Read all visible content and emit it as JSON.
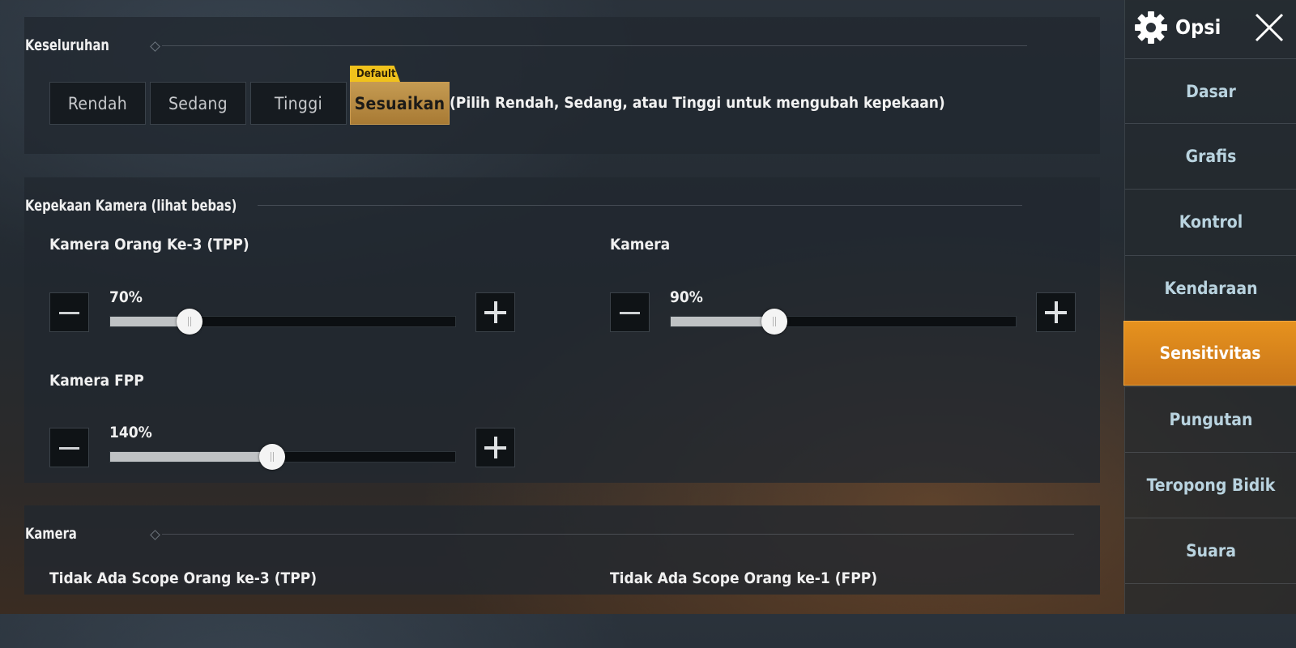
{
  "overall": {
    "title": "Keseluruhan",
    "presets": [
      "Rendah",
      "Sedang",
      "Tinggi",
      "Sesuaikan"
    ],
    "selected_preset": "Sesuaikan",
    "default_tag": "Default",
    "hint": "(Pilih Rendah, Sedang, atau Tinggi untuk mengubah kepekaan)"
  },
  "camera_sensitivity": {
    "title": "Kepekaan Kamera (lihat bebas)",
    "tpp": {
      "label": "Kamera Orang Ke-3 (TPP)",
      "value_text": "70%",
      "fraction": 0.23
    },
    "camera": {
      "label": "Kamera",
      "value_text": "90%",
      "fraction": 0.3
    },
    "fpp": {
      "label": "Kamera FPP",
      "value_text": "140%",
      "fraction": 0.47
    }
  },
  "camera_section": {
    "title": "Kamera",
    "no_scope_tpp": "Tidak Ada Scope Orang ke-3 (TPP)",
    "no_scope_fpp": "Tidak Ada Scope Orang ke-1 (FPP)"
  },
  "sidebar": {
    "title": "Opsi",
    "items": [
      "Dasar",
      "Grafis",
      "Kontrol",
      "Kendaraan",
      "Sensitivitas",
      "Pungutan",
      "Teropong Bidik",
      "Suara"
    ],
    "active": "Sensitivitas"
  },
  "colors": {
    "accent_orange": "#e6921e",
    "preset_gold": "#c59b52",
    "default_tag_yellow": "#f0c21c"
  },
  "icons": {
    "settings": "gear-icon",
    "close": "close-icon",
    "minus": "minus-icon",
    "plus": "plus-icon"
  }
}
